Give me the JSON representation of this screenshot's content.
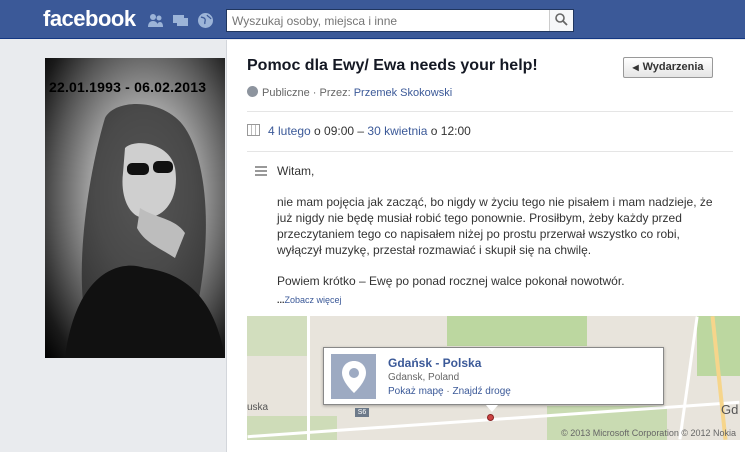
{
  "topbar": {
    "logo": "facebook",
    "search_placeholder": "Wyszukaj osoby, miejsca i inne",
    "icons": [
      "friends-icon",
      "messages-icon",
      "globe-icon",
      "search-icon"
    ]
  },
  "photo": {
    "dates": "22.01.1993 - 06.02.2013"
  },
  "event": {
    "title": "Pomoc dla Ewy/ Ewa needs your help!",
    "back_button": "Wydarzenia",
    "privacy": "Publiczne",
    "by_label": " · Przez: ",
    "author": "Przemek Skokowski",
    "start_date": "4 lutego",
    "o1": " o 09:00 – ",
    "end_date": "30 kwietnia",
    "o2": " o 12:00",
    "description": [
      "Witam,",
      "nie mam pojęcia jak zacząć, bo nigdy w życiu tego nie pisałem i mam nadzieje, że już nigdy nie będę musiał robić tego ponownie. Prosiłbym, żeby każdy przed przeczytaniem tego co napisałem niżej po prostu przerwał wszystko co robi, wyłączył muzykę, przestał rozmawiać i skupił się na chwilę.",
      "Powiem krótko – Ewę po ponad rocznej walce pokonał nowotwór."
    ],
    "more_prefix": "...",
    "more_link": "Zobacz więcej"
  },
  "map": {
    "place": "Gdańsk - Polska",
    "sub": "Gdansk, Poland",
    "show_map": "Pokaż mapę",
    "dot": " · ",
    "directions": "Znajdź drogę",
    "road_label": "S6",
    "left_label": "uska",
    "right_label": "Gd",
    "copyright": "© 2013 Microsoft Corporation © 2012 Nokia"
  },
  "colors": {
    "brand": "#3b5998",
    "link": "#3b5998"
  }
}
